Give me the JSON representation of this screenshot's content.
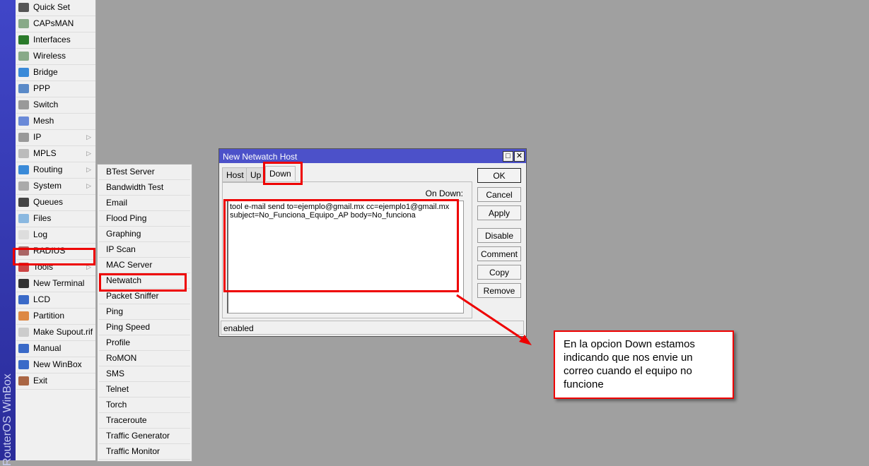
{
  "brand": "RouterOS WinBox",
  "menu": [
    {
      "label": "Quick Set",
      "icon": "wand-icon",
      "color": "#555"
    },
    {
      "label": "CAPsMAN",
      "icon": "antenna-icon",
      "color": "#8a8"
    },
    {
      "label": "Interfaces",
      "icon": "interface-card-icon",
      "color": "#2a7a2a"
    },
    {
      "label": "Wireless",
      "icon": "antenna-icon",
      "color": "#8a8"
    },
    {
      "label": "Bridge",
      "icon": "bridge-icon",
      "color": "#3a8ad8"
    },
    {
      "label": "PPP",
      "icon": "ppp-icon",
      "color": "#5a8ac8"
    },
    {
      "label": "Switch",
      "icon": "switch-icon",
      "color": "#999"
    },
    {
      "label": "Mesh",
      "icon": "mesh-icon",
      "color": "#6a8ad8"
    },
    {
      "label": "IP",
      "icon": "ip-icon",
      "color": "#999",
      "submenu": true
    },
    {
      "label": "MPLS",
      "icon": "tag-icon",
      "color": "#bbb",
      "submenu": true
    },
    {
      "label": "Routing",
      "icon": "routing-icon",
      "color": "#3a8ad8",
      "submenu": true
    },
    {
      "label": "System",
      "icon": "gear-icon",
      "color": "#aaa",
      "submenu": true
    },
    {
      "label": "Queues",
      "icon": "gauge-icon",
      "color": "#444"
    },
    {
      "label": "Files",
      "icon": "folder-icon",
      "color": "#8ab8e0"
    },
    {
      "label": "Log",
      "icon": "log-icon",
      "color": "#ddd"
    },
    {
      "label": "RADIUS",
      "icon": "radius-icon",
      "color": "#a66"
    },
    {
      "label": "Tools",
      "icon": "tools-icon",
      "color": "#c44",
      "submenu": true
    },
    {
      "label": "New Terminal",
      "icon": "terminal-icon",
      "color": "#333"
    },
    {
      "label": "LCD",
      "icon": "lcd-icon",
      "color": "#3a6ac8"
    },
    {
      "label": "Partition",
      "icon": "pie-icon",
      "color": "#d84"
    },
    {
      "label": "Make Supout.rif",
      "icon": "document-icon",
      "color": "#ccc"
    },
    {
      "label": "Manual",
      "icon": "help-icon",
      "color": "#3a6ac8"
    },
    {
      "label": "New WinBox",
      "icon": "globe-icon",
      "color": "#3a6ac8"
    },
    {
      "label": "Exit",
      "icon": "door-icon",
      "color": "#a64"
    }
  ],
  "tools_submenu": [
    "BTest Server",
    "Bandwidth Test",
    "Email",
    "Flood Ping",
    "Graphing",
    "IP Scan",
    "MAC Server",
    "Netwatch",
    "Packet Sniffer",
    "Ping",
    "Ping Speed",
    "Profile",
    "RoMON",
    "SMS",
    "Telnet",
    "Torch",
    "Traceroute",
    "Traffic Generator",
    "Traffic Monitor"
  ],
  "dialog": {
    "title": "New Netwatch Host",
    "tabs": [
      "Host",
      "Up",
      "Down"
    ],
    "active_tab": "Down",
    "field_label": "On Down:",
    "script_lines": [
      "tool e-mail send to=ejemplo@gmail.mx cc=ejemplo1@gmail.mx",
      "subject=No_Funciona_Equipo_AP body=No_funciona"
    ],
    "buttons": [
      "OK",
      "Cancel",
      "Apply",
      "Disable",
      "Comment",
      "Copy",
      "Remove"
    ],
    "status": "enabled"
  },
  "annotation": "En la opcion Down estamos indicando que nos envie un correo cuando el equipo no funcione",
  "highlight_color": "#e00000"
}
